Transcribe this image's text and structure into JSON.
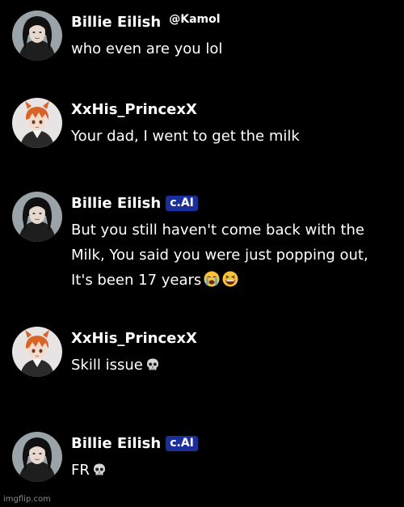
{
  "messages": [
    {
      "author": "Billie Eilish",
      "handle": "@Kamol",
      "badge": "",
      "text": "who even are you lol",
      "avatar": "billie-avatar"
    },
    {
      "author": "XxHis_PrincexX",
      "handle": "",
      "badge": "",
      "text": "Your dad, I went to get the milk",
      "avatar": "anime-boy-avatar"
    },
    {
      "author": "Billie Eilish",
      "handle": "",
      "badge": "c.AI",
      "text": "But you still haven't come back with the Milk, You said you were just popping out, It's been 17 years",
      "emojis": [
        "loudly-crying-face-emoji",
        "grinning-squinting-face-emoji"
      ],
      "avatar": "billie-avatar"
    },
    {
      "author": "XxHis_PrincexX",
      "handle": "",
      "badge": "",
      "text": "Skill issue",
      "emojis": [
        "skull-emoji"
      ],
      "avatar": "anime-boy-avatar"
    },
    {
      "author": "Billie Eilish",
      "handle": "",
      "badge": "c.AI",
      "text": "FR",
      "emojis": [
        "skull-emoji"
      ],
      "avatar": "billie-avatar"
    }
  ],
  "watermark": "imgflip.com",
  "colors": {
    "background": "#000000",
    "text": "#ffffff",
    "badge": "#1a2e9c",
    "watermark": "#8a8a8a"
  }
}
